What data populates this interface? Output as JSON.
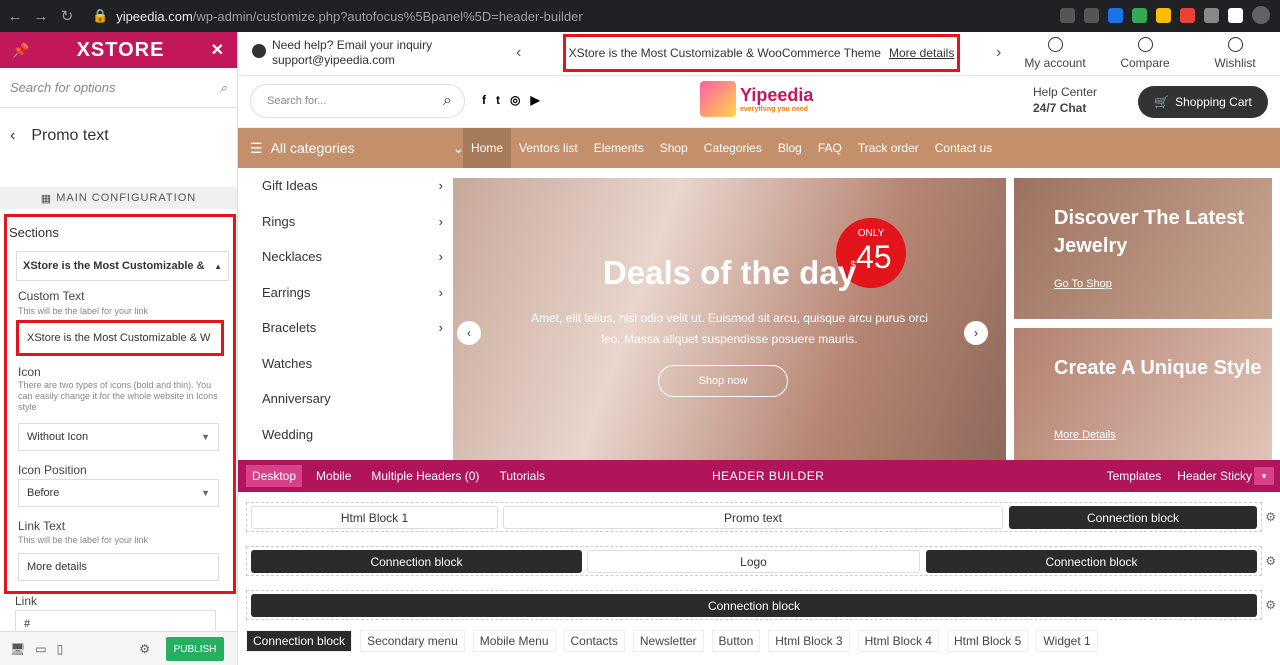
{
  "browser": {
    "url_host": "yipeedia.com",
    "url_path": "/wp-admin/customize.php?autofocus%5Bpanel%5D=header-builder"
  },
  "sidebar": {
    "brand": "XSTORE",
    "search_placeholder": "Search for options",
    "back_title": "Promo text",
    "main_config": "MAIN CONFIGURATION",
    "sections_label": "Sections",
    "accordion_title": "XStore is the Most Customizable &",
    "custom_text_label": "Custom Text",
    "custom_text_hint": "This will be the label for your link",
    "custom_text_value": "XStore is the Most Customizable & W",
    "icon_label": "Icon",
    "icon_hint": "There are two types of icons (bold and thin). You can easily change it for the whole website in Icons style",
    "icon_value": "Without Icon",
    "icon_position_label": "Icon Position",
    "icon_position_value": "Before",
    "link_text_label": "Link Text",
    "link_text_hint": "This will be the label for your link",
    "link_text_value": "More details",
    "link_label": "Link",
    "link_value": "#",
    "publish": "PUBLISH"
  },
  "preview": {
    "help_line1": "Need help? Email your inquiry",
    "help_line2": "support@yipeedia.com",
    "promo_text": "XStore is the Most Customizable & WooCommerce Theme",
    "promo_link": "More details",
    "tools": [
      "My account",
      "Compare",
      "Wishlist"
    ],
    "search_placeholder": "Search for...",
    "logo_title": "Yipeedia",
    "logo_sub": "everything you need",
    "help_center": "Help Center",
    "chat": "24/7 Chat",
    "cart": "Shopping Cart",
    "cart_count": "0",
    "all_categories": "All categories",
    "nav": [
      "Home",
      "Ventors list",
      "Elements",
      "Shop",
      "Categories",
      "Blog",
      "FAQ",
      "Track order",
      "Contact us"
    ],
    "categories": [
      "Gift Ideas",
      "Rings",
      "Necklaces",
      "Earrings",
      "Bracelets",
      "Watches",
      "Anniversary",
      "Wedding"
    ],
    "hero_title": "Deals of the day",
    "hero_text": "Amet, elit tellus, nisi odio velit ut. Euismod sit arcu, quisque arcu purus orci leo. Massa aliquet suspendisse posuere mauris.",
    "hero_button": "Shop now",
    "badge_only": "ONLY",
    "badge_price": "45",
    "badge_currency": "$",
    "side1_title": "Discover The Latest Jewelry",
    "side1_link": "Go To Shop",
    "side2_title": "Create A Unique Style",
    "side2_link": "More Details"
  },
  "builder": {
    "tabs": [
      "Desktop",
      "Mobile",
      "Multiple Headers (0)",
      "Tutorials"
    ],
    "title": "HEADER BUILDER",
    "right": [
      "Templates",
      "Header Sticky"
    ],
    "row1": [
      "Html Block 1",
      "Promo text",
      "Connection block"
    ],
    "row2": [
      "Connection block",
      "Logo",
      "Connection block"
    ],
    "row3": [
      "Connection block"
    ],
    "items": [
      "Connection block",
      "Secondary menu",
      "Mobile Menu",
      "Contacts",
      "Newsletter",
      "Button",
      "Html Block 3",
      "Html Block 4",
      "Html Block 5",
      "Widget 1"
    ]
  }
}
